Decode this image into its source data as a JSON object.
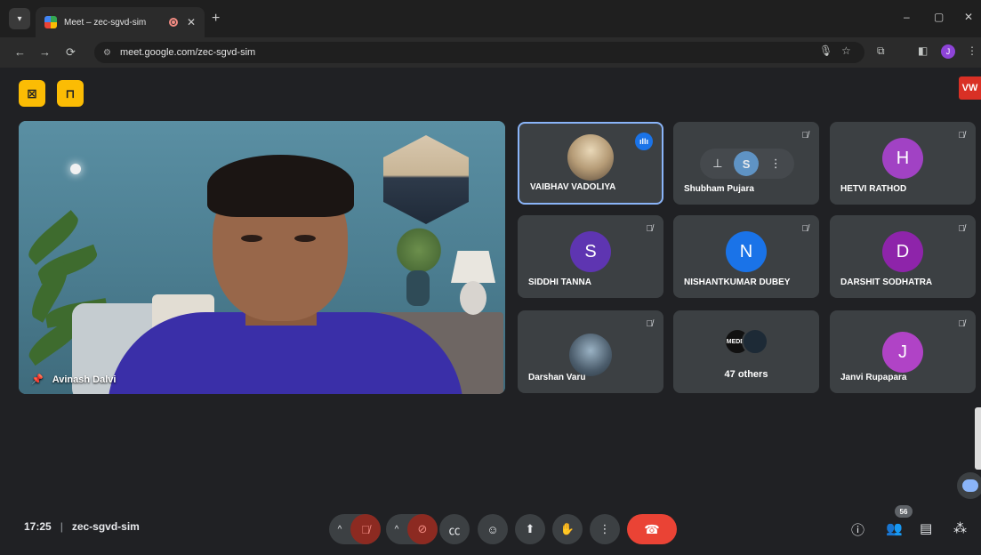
{
  "browser": {
    "tab_title": "Meet – zec-sgvd-sim",
    "url": "meet.google.com/zec-sgvd-sim",
    "profile_initial": "J",
    "new_tab": "+",
    "close_tab": "✕"
  },
  "brand_logo": "VW",
  "main_speaker": {
    "name": "Avinash Dalvi"
  },
  "participants": [
    {
      "name": "VAIBHAV VADOLIYA",
      "avatar": "photo",
      "speaking": true
    },
    {
      "name": "Shubham Pujara",
      "avatar_letter": "S",
      "hovered": true
    },
    {
      "name": "HETVI RATHOD",
      "avatar_letter": "H",
      "color": "#a142c4"
    },
    {
      "name": "SIDDHI TANNA",
      "avatar_letter": "S",
      "color": "#5e35b1"
    },
    {
      "name": "NISHANTKUMAR DUBEY",
      "avatar_letter": "N",
      "color": "#1a73e8"
    },
    {
      "name": "DARSHIT SODHATRA",
      "avatar_letter": "D",
      "color": "#8e24aa"
    },
    {
      "name": "Darshan Varu",
      "avatar": "photo"
    },
    {
      "others_label": "47 others",
      "avatar_text": "MEDEL"
    },
    {
      "name": "Janvi Rupapara",
      "avatar_letter": "J",
      "color": "#b043c6"
    }
  ],
  "meeting": {
    "time": "17:25",
    "separator": "|",
    "code": "zec-sgvd-sim",
    "participant_count": "56"
  },
  "colors": {
    "accent": "#8ab4f8",
    "hangup": "#ea4335",
    "yellow_btn": "#fbbc04"
  }
}
